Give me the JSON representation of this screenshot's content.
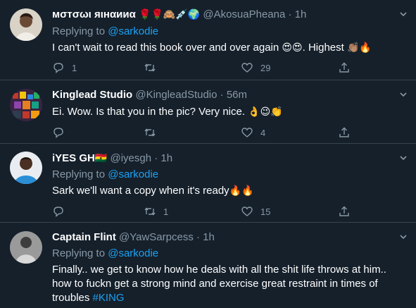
{
  "tweets": [
    {
      "name": "мσтσωι яιнαииα",
      "name_emojis": "🌹🌹🙈💉🌍",
      "handle": "@AkosuaPheana",
      "dot": "·",
      "time": "1h",
      "replying_prefix": "Replying to",
      "replying_to": "@sarkodie",
      "text": "I can't wait to read this book over and over again",
      "text_emoji_a": "😍😍",
      "text_b": ". Highest",
      "text_emoji_b": "👏🏽🔥",
      "reply_count": "1",
      "retweet_count": "",
      "like_count": "29"
    },
    {
      "name": "Kinglead Studio",
      "handle": "@KingleadStudio",
      "dot": "·",
      "time": "56m",
      "text": "Ei. Wow. Is that you in the pic? Very nice.",
      "text_emoji_a": "👌😉👏",
      "reply_count": "",
      "retweet_count": "",
      "like_count": "4"
    },
    {
      "name": "iYES GH",
      "name_emojis": "🇬🇭",
      "handle": "@iyesgh",
      "dot": "·",
      "time": "1h",
      "replying_prefix": "Replying to",
      "replying_to": "@sarkodie",
      "text": "Sark we'll want a copy when it's ready",
      "text_emoji_a": "🔥🔥",
      "reply_count": "",
      "retweet_count": "1",
      "like_count": "15"
    },
    {
      "name": "Captain Flint",
      "handle": "@YawSarpcess",
      "dot": "·",
      "time": "1h",
      "replying_prefix": "Replying to",
      "replying_to": "@sarkodie",
      "text": "Finally.. we get to know how he deals with all the shit life throws at him.. how to fuckn get a strong mind and exercise great restraint in times of troubles",
      "hashtag": "#KING"
    }
  ],
  "colors": {
    "background": "#15202b",
    "divider": "#38444d",
    "secondary_text": "#8899a6",
    "link": "#1da1f2"
  }
}
